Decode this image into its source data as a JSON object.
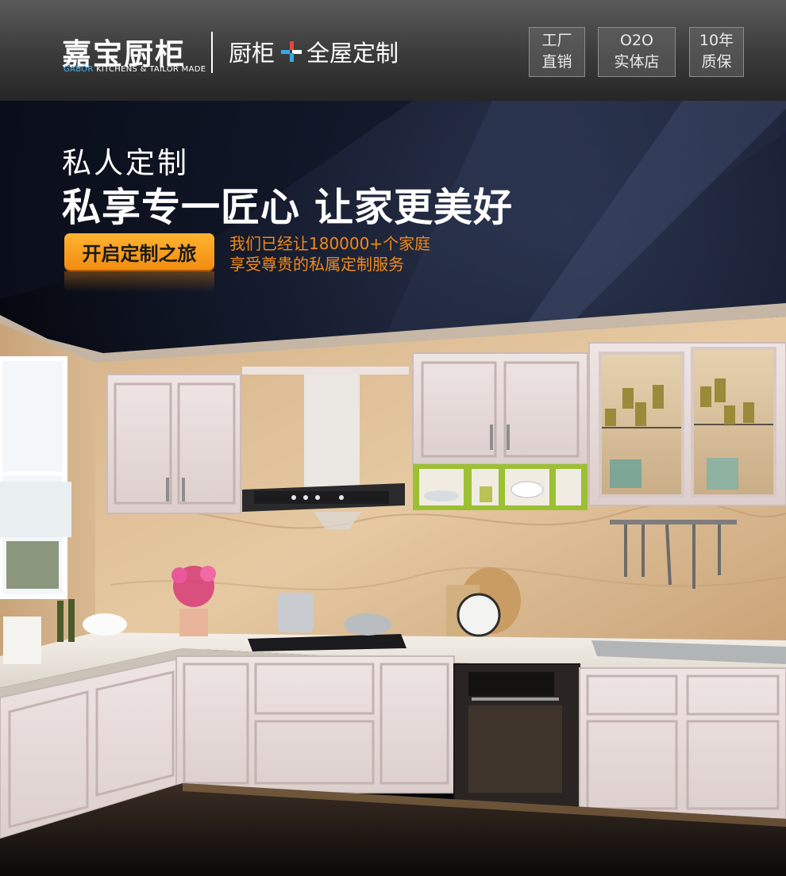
{
  "header": {
    "logo_cn": "嘉宝厨柜",
    "logo_en_brand": "GABÖR",
    "logo_en_rest": " KITCHENS & TAILOR MADE",
    "tagline_left": "厨柜",
    "tagline_right": "全屋定制",
    "plus_icon": "plus-icon",
    "badges": [
      {
        "line1": "工厂",
        "line2": "直销"
      },
      {
        "line1": "O2O",
        "line2": "实体店"
      },
      {
        "line1": "10年",
        "line2": "质保"
      }
    ]
  },
  "hero": {
    "kicker": "私人定制",
    "headline": "私享专一匠心 让家更美好",
    "cta_label": "开启定制之旅",
    "description": {
      "line1": "我们已经让180000+个家庭",
      "line2": "享受尊贵的私属定制服务"
    }
  },
  "colors": {
    "accent_orange": "#f28a17",
    "plus_blue": "#35a9e6",
    "plus_red": "#e8473c"
  }
}
